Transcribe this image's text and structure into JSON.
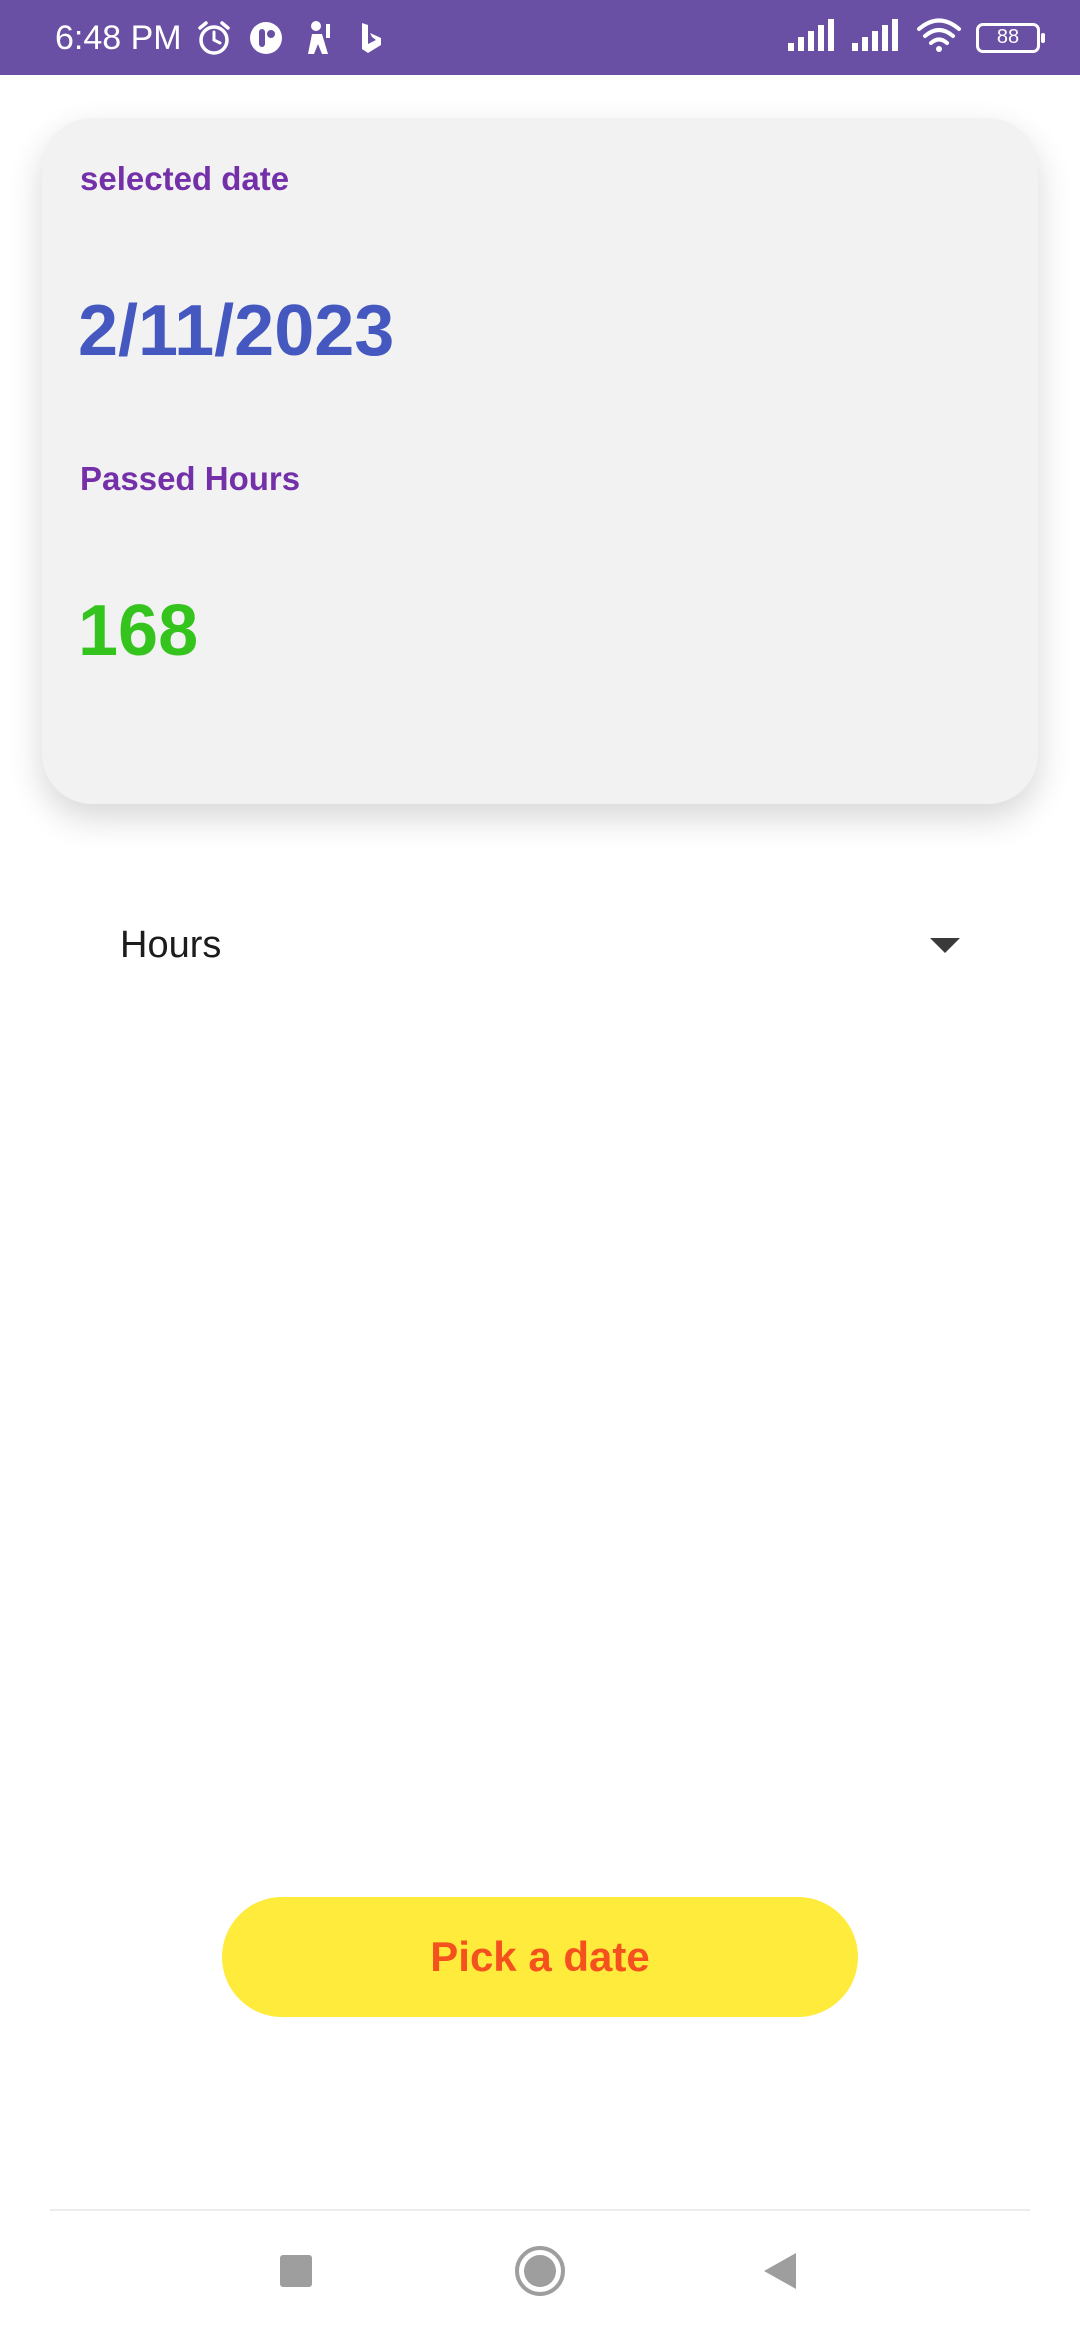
{
  "status_bar": {
    "time": "6:48 PM",
    "battery": "88",
    "icons": [
      "alarm-icon",
      "app-icon",
      "person-icon",
      "bing-icon",
      "signal-icon",
      "signal-icon",
      "wifi-icon",
      "battery-icon"
    ]
  },
  "card": {
    "date_label": "selected date",
    "date_value": "2/11/2023",
    "hours_label": "Passed Hours",
    "hours_value": "168"
  },
  "dropdown": {
    "selected": "Hours"
  },
  "button": {
    "label": "Pick a date"
  },
  "nav": {
    "icons": [
      "recent-apps-icon",
      "home-icon",
      "back-icon"
    ]
  },
  "colors": {
    "status_bar": "#6a50a4",
    "label": "#7430a8",
    "date": "#4558c0",
    "hours": "#34c41d",
    "button_bg": "#ffeb3b",
    "button_text": "#f4511e"
  }
}
